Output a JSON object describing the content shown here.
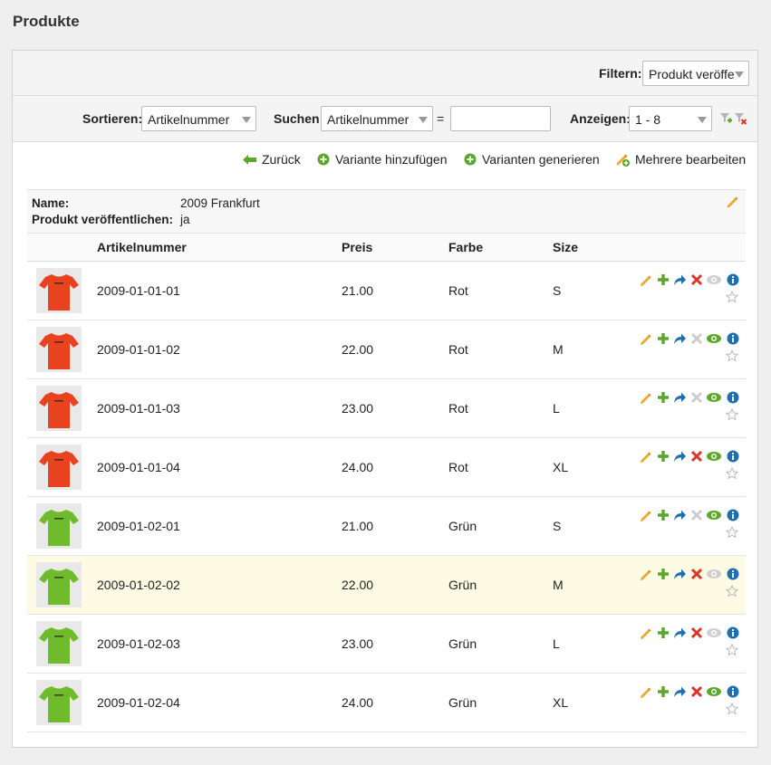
{
  "page": {
    "title": "Produkte"
  },
  "filter_bar": {
    "label": "Filtern:",
    "selected": "Produkt veröffe"
  },
  "sort_bar": {
    "sort_label": "Sortieren:",
    "sort_value": "Artikelnummer",
    "search_label": "Suchen:",
    "search_field": "Artikelnummer",
    "equals": "=",
    "search_value": "",
    "show_label": "Anzeigen:",
    "show_value": "1 - 8"
  },
  "actions": {
    "back": "Zurück",
    "add_variant": "Variante hinzufügen",
    "generate_variants": "Varianten generieren",
    "bulk_edit": "Mehrere bearbeiten"
  },
  "product": {
    "name_label": "Name:",
    "name": "2009 Frankfurt",
    "published_label": "Produkt veröffentlichen:",
    "published": "ja"
  },
  "table": {
    "headers": {
      "sku": "Artikelnummer",
      "price": "Preis",
      "color": "Farbe",
      "size": "Size"
    },
    "rows": [
      {
        "sku": "2009-01-01-01",
        "price": "21.00",
        "color": "Rot",
        "size": "S",
        "shirt_color": "#e8421f",
        "delete_active": true,
        "visible": false
      },
      {
        "sku": "2009-01-01-02",
        "price": "22.00",
        "color": "Rot",
        "size": "M",
        "shirt_color": "#e8421f",
        "delete_active": false,
        "visible": true
      },
      {
        "sku": "2009-01-01-03",
        "price": "23.00",
        "color": "Rot",
        "size": "L",
        "shirt_color": "#e8421f",
        "delete_active": false,
        "visible": true
      },
      {
        "sku": "2009-01-01-04",
        "price": "24.00",
        "color": "Rot",
        "size": "XL",
        "shirt_color": "#e8421f",
        "delete_active": true,
        "visible": true
      },
      {
        "sku": "2009-01-02-01",
        "price": "21.00",
        "color": "Grün",
        "size": "S",
        "shirt_color": "#6fbb2c",
        "delete_active": false,
        "visible": true
      },
      {
        "sku": "2009-01-02-02",
        "price": "22.00",
        "color": "Grün",
        "size": "M",
        "shirt_color": "#6fbb2c",
        "delete_active": true,
        "visible": false
      },
      {
        "sku": "2009-01-02-03",
        "price": "23.00",
        "color": "Grün",
        "size": "L",
        "shirt_color": "#6fbb2c",
        "delete_active": true,
        "visible": false
      },
      {
        "sku": "2009-01-02-04",
        "price": "24.00",
        "color": "Grün",
        "size": "XL",
        "shirt_color": "#6fbb2c",
        "delete_active": true,
        "visible": true
      }
    ]
  },
  "row_icons": [
    "pencil-icon",
    "plus-icon",
    "redirect-arrow-icon",
    "delete-icon",
    "visibility-eye-icon",
    "info-icon",
    "star-icon"
  ],
  "colors": {
    "accent_green": "#5aa82a",
    "pencil": "#f0a830",
    "delete_red": "#d9352b",
    "info_blue": "#1e6fb0",
    "arrow_blue": "#1f6fae",
    "highlight_row": "#fdfbe3"
  }
}
